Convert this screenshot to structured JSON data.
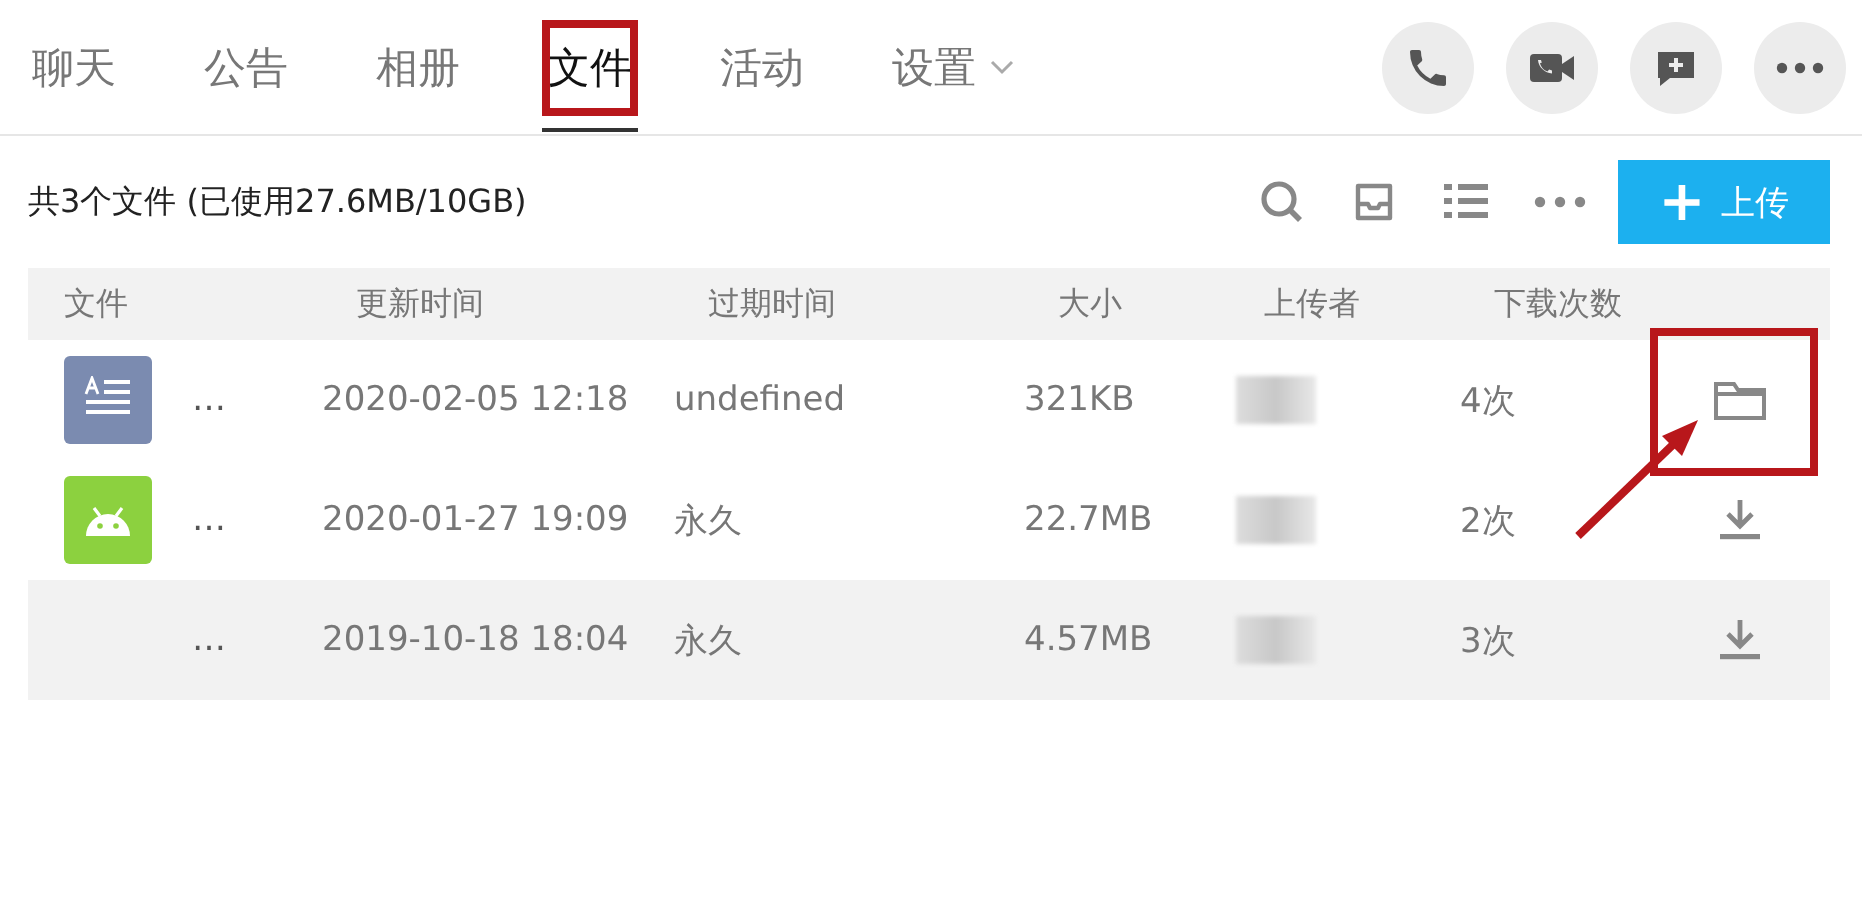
{
  "tabs": [
    {
      "label": "聊天",
      "selected": false,
      "highlighted": false
    },
    {
      "label": "公告",
      "selected": false,
      "highlighted": false
    },
    {
      "label": "相册",
      "selected": false,
      "highlighted": false
    },
    {
      "label": "文件",
      "selected": true,
      "highlighted": true
    },
    {
      "label": "活动",
      "selected": false,
      "highlighted": false
    },
    {
      "label": "设置",
      "selected": false,
      "highlighted": false,
      "dropdown": true
    }
  ],
  "header_actions": [
    {
      "kind": "phone"
    },
    {
      "kind": "video"
    },
    {
      "kind": "message"
    },
    {
      "kind": "more"
    }
  ],
  "summary": "共3个文件 (已使用27.6MB/10GB)",
  "toolbar": [
    {
      "kind": "search"
    },
    {
      "kind": "inbox"
    },
    {
      "kind": "list"
    },
    {
      "kind": "more"
    }
  ],
  "upload_button": {
    "icon": "+",
    "label": "上传"
  },
  "table": {
    "columns": [
      "文件",
      "更新时间",
      "过期时间",
      "大小",
      "上传者",
      "下载次数"
    ],
    "rows": [
      {
        "kind": "doc",
        "name": "…",
        "updated": "2020-02-05 12:18",
        "expires": "undefined",
        "size": "321KB",
        "downloads": "4次",
        "action": {
          "kind": "folder"
        },
        "highlighted": true,
        "hovered": false
      },
      {
        "kind": "android",
        "name": "…",
        "updated": "2020-01-27 19:09",
        "expires": "永久",
        "size": "22.7MB",
        "downloads": "2次",
        "action": {
          "kind": "download"
        },
        "highlighted": false,
        "hovered": false
      },
      {
        "kind": "blank",
        "name": "…",
        "updated": "2019-10-18 18:04",
        "expires": "永久",
        "size": "4.57MB",
        "downloads": "3次",
        "action": {
          "kind": "download"
        },
        "highlighted": false,
        "hovered": true
      }
    ]
  }
}
